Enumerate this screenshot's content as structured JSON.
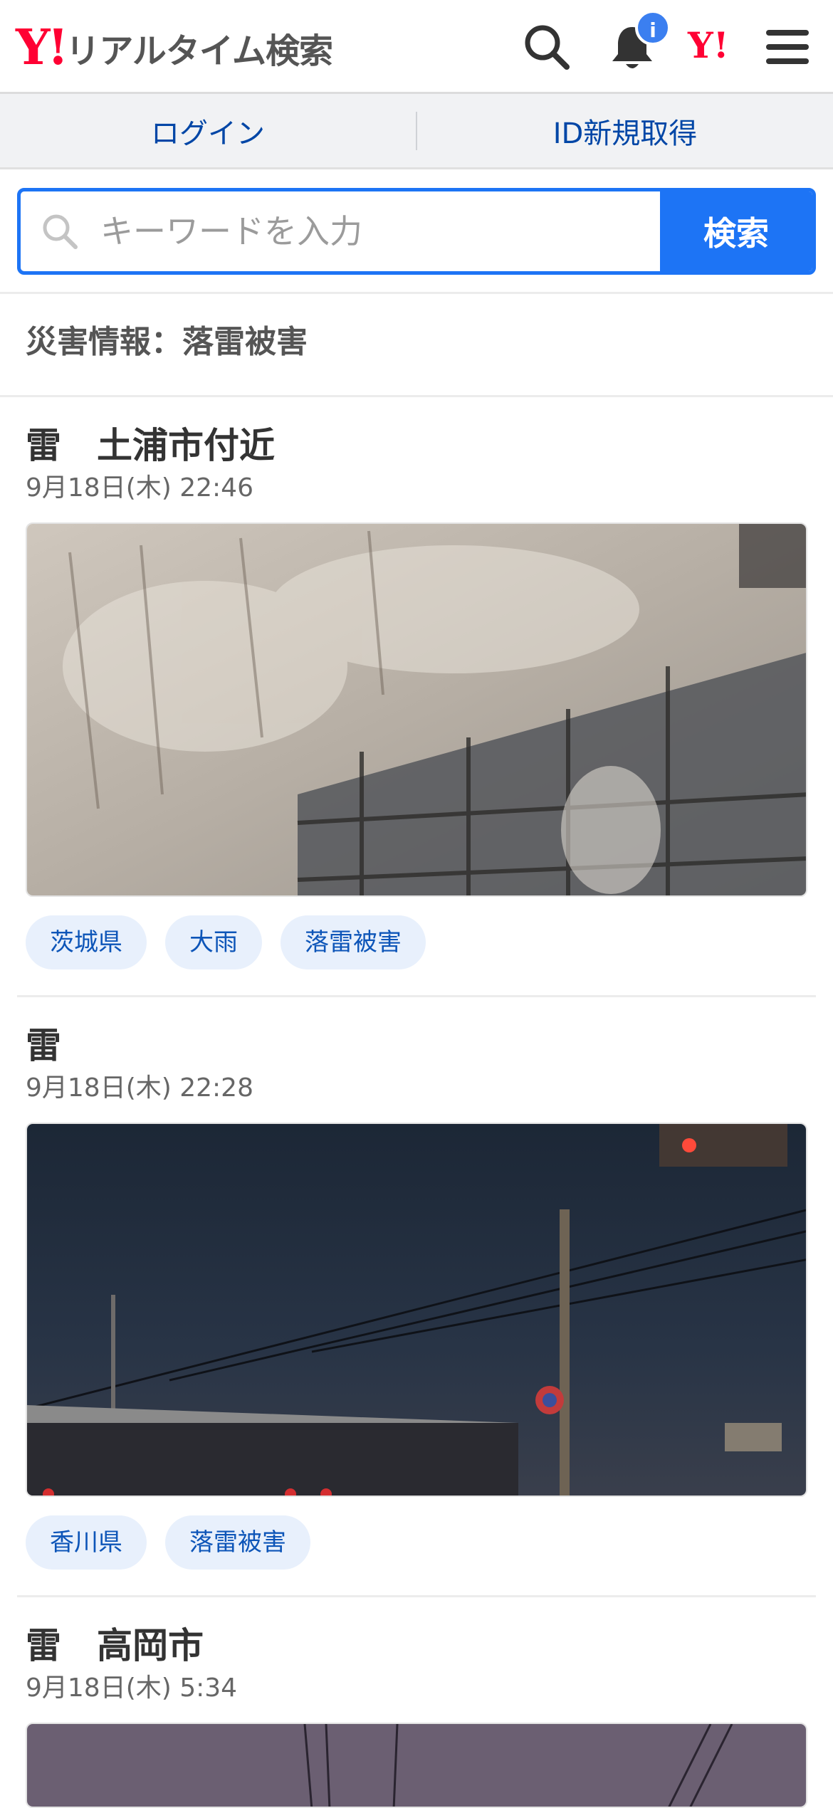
{
  "header": {
    "logo_mark": "Y!",
    "logo_text": "リアルタイム検索",
    "notification_badge": "i",
    "yahoo_link": "Y!",
    "icons": [
      "search-icon",
      "bell-icon",
      "yahoo-logo",
      "hamburger-menu-icon"
    ],
    "brand_color": "#ff0033"
  },
  "login_bar": {
    "login_label": "ログイン",
    "signup_label": "ID新規取得"
  },
  "search": {
    "placeholder": "キーワードを入力",
    "button_label": "検索",
    "accent_color": "#1d74f5"
  },
  "section": {
    "title": "災害情報：落雷被害"
  },
  "items": [
    {
      "title": "雷　土浦市付近",
      "time": "9月18日(木) 22:46",
      "tags": [
        "茨城県",
        "大雨",
        "落雷被害"
      ]
    },
    {
      "title": "雷",
      "time": "9月18日(木) 22:28",
      "tags": [
        "香川県",
        "落雷被害"
      ]
    },
    {
      "title": "雷　高岡市",
      "time": "9月18日(木) 5:34",
      "tags": []
    }
  ]
}
